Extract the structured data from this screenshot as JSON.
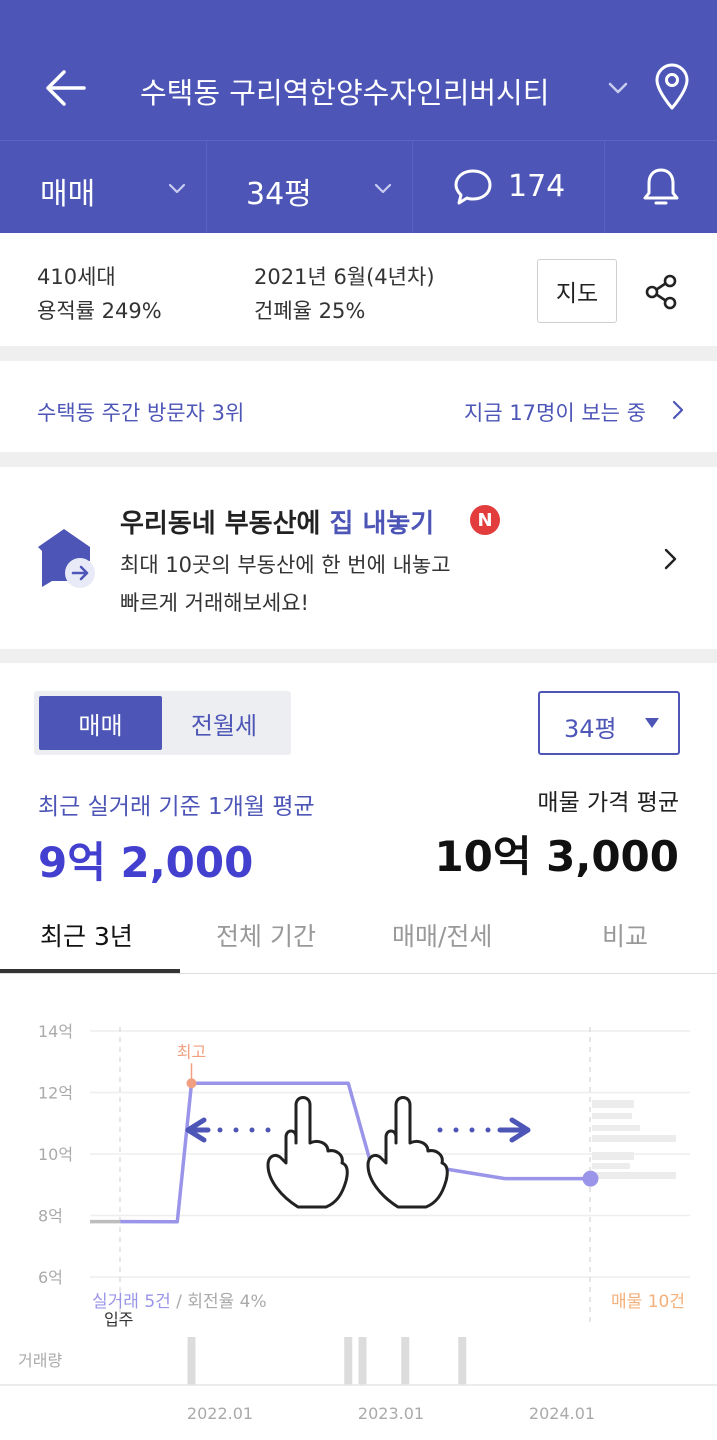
{
  "header": {
    "title": "수택동 구리역한양수자인리버시티",
    "icons": [
      "back-arrow-icon",
      "chevron-down-icon",
      "location-pin-icon"
    ]
  },
  "tabbar": {
    "trade_type": "매매",
    "size": "34평",
    "comment_count": "174",
    "icons": [
      "chat-bubble-icon",
      "bell-icon"
    ]
  },
  "complex_info": {
    "households": "410세대",
    "far": "용적률 249%",
    "built": "2021년 6월(4년차)",
    "bcr": "건폐율 25%",
    "map_label": "지도"
  },
  "visitors": {
    "rank": "수택동 주간 방문자 3위",
    "watching": "지금 17명이 보는 중"
  },
  "promo": {
    "title_prefix": "우리동네 부동산에 ",
    "title_highlight": "집 내놓기",
    "badge": "N",
    "line1": "최대 10곳의 부동산에 한 번에 내놓고",
    "line2": "빠르게 거래해보세요!"
  },
  "price_summary": {
    "seg_sale": "매매",
    "seg_rent": "전월세",
    "size_select": "34평",
    "recent_label": "최근 실거래 기준 1개월 평균",
    "recent_value": "9억 2,000",
    "asking_label": "매물 가격 평균",
    "asking_value": "10억 3,000"
  },
  "period_tabs": {
    "tabs": [
      "최근 3년",
      "전체 기간",
      "매매/전세",
      "비교"
    ],
    "active": "최근 3년"
  },
  "chart_data": {
    "type": "line",
    "y_axis": {
      "unit": "억",
      "ylim": [
        6,
        14
      ],
      "ticks": [
        "14억",
        "12억",
        "10억",
        "8억",
        "6억"
      ]
    },
    "x_ticks": [
      "2022.01",
      "2023.01",
      "2024.01"
    ],
    "series": [
      {
        "values": [
          {
            "x": "2021.06",
            "y": 7.8
          },
          {
            "x": "2021.10",
            "y": 7.8
          },
          {
            "x": "2021.11",
            "y": 12.3
          },
          {
            "x": "2022.10",
            "y": 12.3
          },
          {
            "x": "2022.12",
            "y": 9.0
          },
          {
            "x": "2023.05",
            "y": 9.5
          },
          {
            "x": "2023.09",
            "y": 9.2
          },
          {
            "x": "2024.03",
            "y": 9.2
          }
        ]
      }
    ],
    "peak_label": "최고",
    "move_in_label": "입주",
    "trade_count_text": "실거래 5건",
    "turnover_text": " / 회전율 4%",
    "listing_count_text": "매물 10건",
    "volume_label": "거래량",
    "volume_bars_x": [
      "2021.11",
      "2022.10",
      "2022.11",
      "2023.02",
      "2023.06"
    ],
    "swipe_hint_icons": [
      "left-arrow-icon",
      "right-arrow-icon",
      "pointing-hand-icon",
      "pointing-hand-icon"
    ],
    "colors": {
      "line": "#9a95e8",
      "peak": "#f0a080",
      "accent": "#4d56b7",
      "listing": "#f3b07a"
    }
  }
}
